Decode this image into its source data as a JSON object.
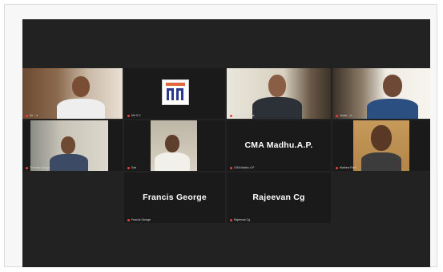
{
  "meeting": {
    "participants": [
      {
        "id": "p1",
        "display_name": "",
        "label": "Sri ...n"
      },
      {
        "id": "p2",
        "display_name": "",
        "label": "Mrf S K"
      },
      {
        "id": "p3",
        "display_name": "",
        "label": "Samuel Thomas",
        "active": true
      },
      {
        "id": "p4",
        "display_name": "",
        "label": "Jacob ...h..."
      },
      {
        "id": "p5",
        "display_name": "",
        "label": "Thomas George"
      },
      {
        "id": "p6",
        "display_name": "",
        "label": "Sab"
      },
      {
        "id": "p7",
        "display_name": "CMA Madhu.A.P.",
        "label": "CMA Madhu A P"
      },
      {
        "id": "p8",
        "display_name": "",
        "label": "Mathew Ravi..."
      },
      {
        "id": "p9",
        "display_name": "Francis George",
        "label": "Francis George"
      },
      {
        "id": "p10",
        "display_name": "Rajeevan Cg",
        "label": "Rajeevan Cg"
      }
    ]
  },
  "icons": {
    "mic_muted": "mic-muted-icon"
  },
  "colors": {
    "active_speaker": "#b5d334",
    "muted": "#e0443e",
    "background": "#222222"
  }
}
